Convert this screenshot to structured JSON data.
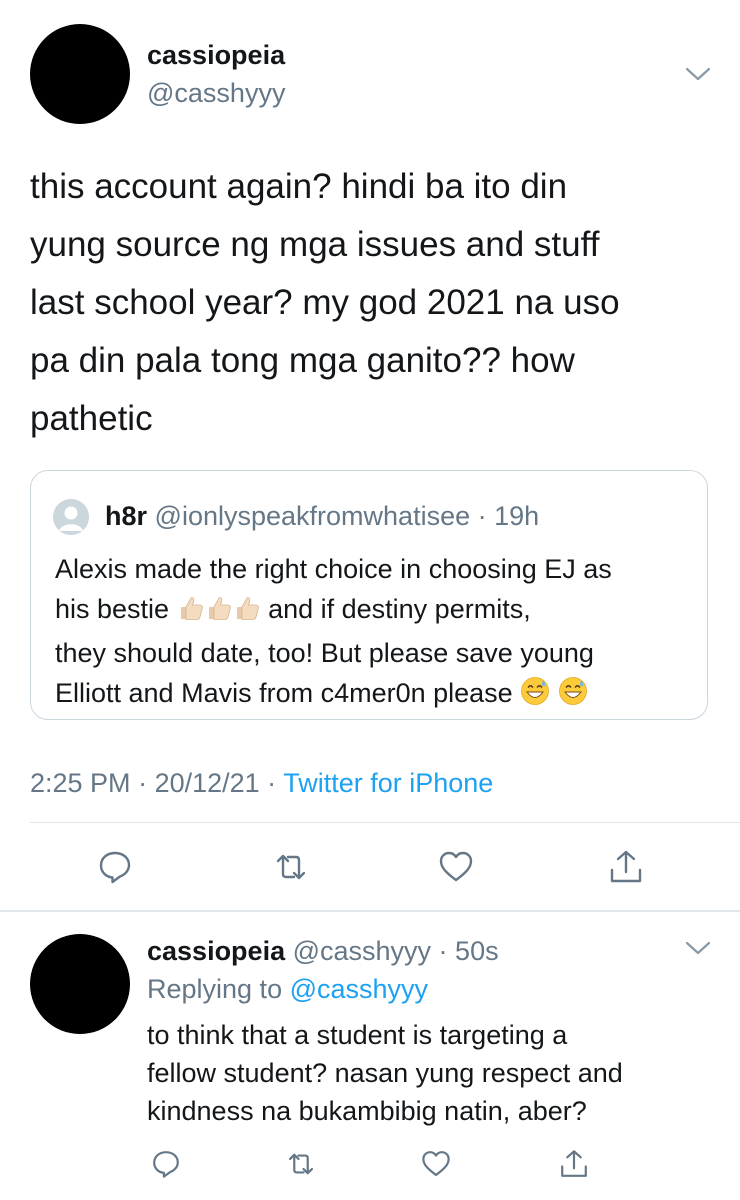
{
  "main_tweet": {
    "display_name": "cassiopeia",
    "handle": "@casshyyy",
    "text_lines": [
      "this account again? hindi ba ito din",
      "yung source ng mga issues and stuff",
      "last school year? my god 2021 na uso",
      "pa din pala tong mga ganito?? how",
      "pathetic"
    ],
    "quoted": {
      "display_name": "h8r",
      "handle": "@ionlyspeakfromwhatisee",
      "separator": " · ",
      "time": "19h",
      "line1": "Alexis made the right choice in choosing EJ as",
      "line2_a": "his bestie ",
      "line2_b": " and if destiny permits,",
      "line3": "they should date, too! But please save young",
      "line4": "Elliott and Mavis from c4mer0n please ",
      "emojis": [
        "thumbs-up-light-skin",
        "thumbs-up-light-skin",
        "thumbs-up-light-skin",
        "grinning-sweat",
        "grinning-sweat"
      ]
    },
    "time": "2:25 PM",
    "sep1": " · ",
    "date": "20/12/21",
    "sep2": " · ",
    "source": "Twitter for iPhone",
    "actions": [
      "reply-icon",
      "retweet-icon",
      "like-icon",
      "share-icon"
    ]
  },
  "reply_tweet": {
    "display_name": "cassiopeia",
    "handle": " @casshyyy",
    "separator": " · ",
    "time": "50s",
    "replying_prefix": "Replying to ",
    "replying_handle": "@casshyyy",
    "text_lines": [
      "to think that a student is targeting a",
      "fellow student? nasan yung respect and",
      "kindness na bukambibig natin, aber?"
    ],
    "actions": [
      "reply-icon",
      "retweet-icon",
      "like-icon",
      "share-icon"
    ]
  },
  "colors": {
    "text_primary": "#14171a",
    "text_secondary": "#657786",
    "link": "#1da1f2",
    "border": "#e1e8ed"
  }
}
